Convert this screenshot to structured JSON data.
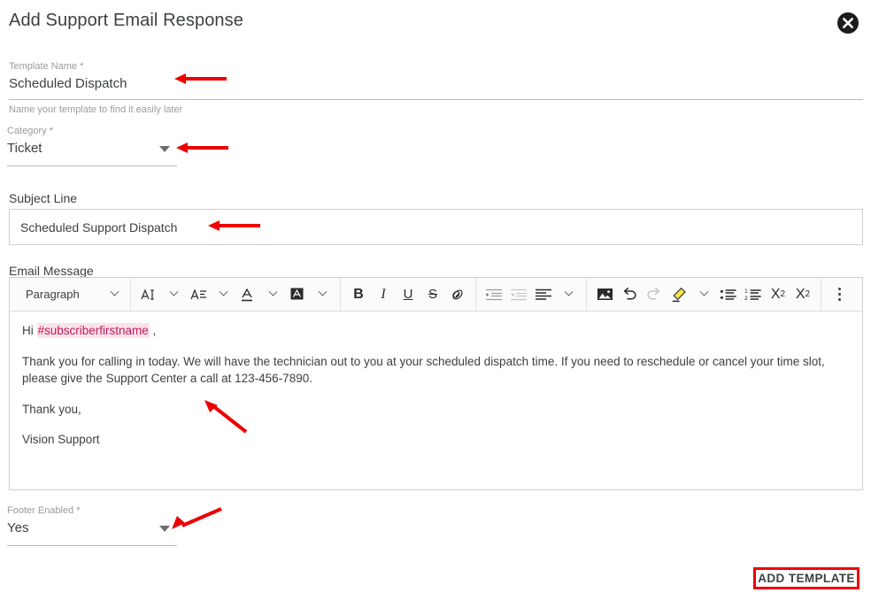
{
  "dialog": {
    "title": "Add Support Email Response",
    "close_icon": "close-circle-icon"
  },
  "fields": {
    "template_name": {
      "label": "Template Name *",
      "value": "Scheduled Dispatch",
      "hint": "Name your template to find it easily later"
    },
    "category": {
      "label": "Category *",
      "value": "Ticket",
      "caret_icon": "chevron-down-icon"
    },
    "subject_line": {
      "label": "Subject Line",
      "value": "Scheduled Support Dispatch"
    },
    "email_message": {
      "label": "Email Message"
    },
    "footer_enabled": {
      "label": "Footer Enabled *",
      "value": "Yes",
      "caret_icon": "chevron-down-icon"
    }
  },
  "toolbar": {
    "paragraph_style": "Paragraph",
    "buttons": [
      {
        "name": "font-size-icon",
        "glyph": "AI",
        "dropdown": true
      },
      {
        "name": "line-height-icon",
        "glyph": "A",
        "dropdown": true
      },
      {
        "name": "text-color-icon",
        "glyph": "A",
        "dropdown": true
      },
      {
        "name": "background-color-icon",
        "glyph": "A",
        "dropdown": true
      },
      {
        "name": "bold-icon",
        "glyph": "B",
        "dropdown": false
      },
      {
        "name": "italic-icon",
        "glyph": "I",
        "dropdown": false
      },
      {
        "name": "underline-icon",
        "glyph": "U",
        "dropdown": false
      },
      {
        "name": "strikethrough-icon",
        "glyph": "S",
        "dropdown": false
      },
      {
        "name": "link-icon",
        "glyph": "link",
        "dropdown": false
      },
      {
        "name": "indent-increase-icon",
        "glyph": "",
        "dropdown": false
      },
      {
        "name": "indent-decrease-icon",
        "glyph": "",
        "dropdown": false
      },
      {
        "name": "align-icon",
        "glyph": "",
        "dropdown": true
      },
      {
        "name": "image-icon",
        "glyph": "",
        "dropdown": false
      },
      {
        "name": "undo-icon",
        "glyph": "",
        "dropdown": false
      },
      {
        "name": "redo-icon",
        "glyph": "",
        "dropdown": false
      },
      {
        "name": "highlighter-icon",
        "glyph": "",
        "dropdown": true
      },
      {
        "name": "bullet-list-icon",
        "glyph": "",
        "dropdown": false
      },
      {
        "name": "numbered-list-icon",
        "glyph": "",
        "dropdown": false
      },
      {
        "name": "subscript-icon",
        "glyph": "X2",
        "dropdown": false
      },
      {
        "name": "superscript-icon",
        "glyph": "X2",
        "dropdown": false
      },
      {
        "name": "more-options-icon",
        "glyph": "",
        "dropdown": false
      }
    ]
  },
  "message_body": {
    "greeting_prefix": "Hi ",
    "merge_tag": "#subscriberfirstname",
    "greeting_suffix": " ,",
    "paragraph": "Thank you for calling in today. We will have the technician out to you at your scheduled dispatch time. If you need to reschedule or cancel your time slot, please give the Support Center a call at 123-456-7890.",
    "signoff": "Thank you,",
    "signature": "Vision Support"
  },
  "actions": {
    "add_template": "ADD TEMPLATE"
  },
  "colors": {
    "annotation_red": "#ee0000",
    "merge_tag_text": "#c2185b",
    "merge_tag_bg": "#fbe3ea",
    "text_primary": "#3c4043",
    "label_grey": "#9b9b9b"
  }
}
